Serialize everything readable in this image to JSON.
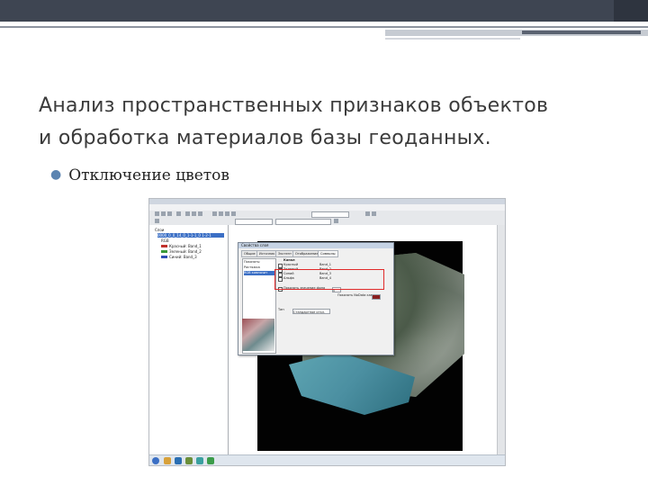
{
  "slide": {
    "title_line1": "Анализ пространственных признаков объектов",
    "title_line2": "и обработка материалов базы геоданных.",
    "bullet": "Отключение цветов",
    "colors": {
      "header_bar": "#3e4552",
      "title_text": "#3b3b3b",
      "bullet_dot": "#5b84b1",
      "dialog_highlight": "#e02b2b"
    }
  },
  "screenshot": {
    "toc": {
      "items": [
        {
          "label": "Слои"
        },
        {
          "label": "0000_0_0_14_0_1-1-1_0 1-2-1"
        },
        {
          "label": "RGB"
        },
        {
          "label": "Красный: Band_1"
        },
        {
          "label": "Зеленый: Band_2"
        },
        {
          "label": "Синий: Band_3"
        }
      ]
    },
    "dialog": {
      "title": "Свойства слоя",
      "tabs": [
        "Общие",
        "Источник",
        "Экстент",
        "Отображение",
        "Символы"
      ],
      "list_label": "Показать:",
      "list_items": [
        "Растяжка",
        "RGB композит"
      ],
      "channel_header": "Канал",
      "channels": [
        {
          "name": "Красный",
          "band": "Band_1"
        },
        {
          "name": "Зеленый",
          "band": "Band_2"
        },
        {
          "name": "Синий",
          "band": "Band_3"
        },
        {
          "name": "Альфа",
          "band": "Band_4"
        }
      ],
      "nodata_label": "Показать значение фона",
      "nodata_value": "0",
      "nodata_color_label": "Показать NoData как",
      "stretch_label": "Тип",
      "stretch_value": "Стандартное откл."
    }
  }
}
